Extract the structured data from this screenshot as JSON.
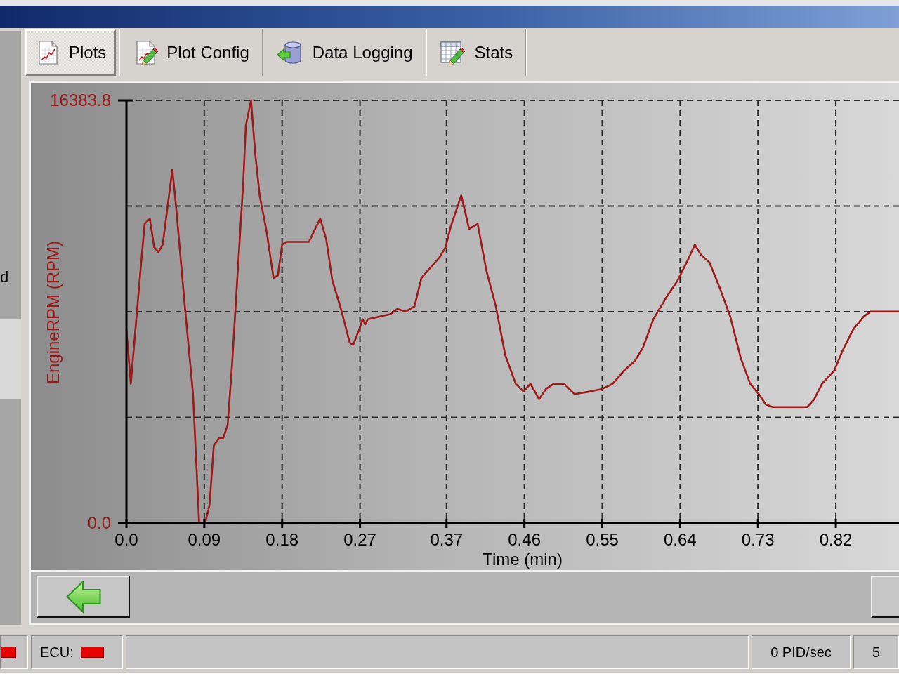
{
  "sidebar": {
    "items": [
      {
        "label": "d",
        "selected": false
      },
      {
        "selected": true
      }
    ]
  },
  "tabs": [
    {
      "label": "Plots",
      "kind": "plot",
      "selected": true
    },
    {
      "label": "Plot Config",
      "kind": "plot_config",
      "selected": false
    },
    {
      "label": "Data Logging",
      "kind": "database",
      "selected": false
    },
    {
      "label": "Stats",
      "kind": "table",
      "selected": false
    }
  ],
  "plot": {
    "chart_data": {
      "type": "line",
      "grid": true,
      "xlabel": "Time (min)",
      "ylabel": "EngineRPM (RPM)",
      "x": [
        0,
        0.005,
        0.016,
        0.021,
        0.027,
        0.032,
        0.037,
        0.042,
        0.053,
        0.057,
        0.067,
        0.077,
        0.084,
        0.091,
        0.096,
        0.101,
        0.107,
        0.112,
        0.117,
        0.122,
        0.128,
        0.135,
        0.138,
        0.144,
        0.149,
        0.154,
        0.162,
        0.17,
        0.175,
        0.18,
        0.185,
        0.211,
        0.224,
        0.231,
        0.238,
        0.248,
        0.258,
        0.262,
        0.269,
        0.273,
        0.276,
        0.279,
        0.292,
        0.305,
        0.313,
        0.323,
        0.333,
        0.341,
        0.362,
        0.369,
        0.375,
        0.387,
        0.392,
        0.396,
        0.406,
        0.416,
        0.427,
        0.438,
        0.45,
        0.459,
        0.467,
        0.477,
        0.485,
        0.494,
        0.506,
        0.518,
        0.536,
        0.55,
        0.562,
        0.575,
        0.588,
        0.597,
        0.609,
        0.625,
        0.637,
        0.649,
        0.657,
        0.664,
        0.674,
        0.686,
        0.698,
        0.71,
        0.721,
        0.731,
        0.739,
        0.747,
        0.787,
        0.795,
        0.804,
        0.818,
        0.828,
        0.84,
        0.852,
        0.86,
        0.893
      ],
      "series": [
        {
          "color": "#a01818",
          "values": [
            7500,
            5400,
            9700,
            11600,
            11800,
            10700,
            10500,
            10800,
            13700,
            12400,
            8600,
            5000,
            0,
            0,
            700,
            3000,
            3300,
            3300,
            3800,
            6100,
            9400,
            13200,
            15400,
            16383.8,
            14300,
            12700,
            11300,
            9500,
            9600,
            10800,
            10900,
            10900,
            11800,
            11000,
            9400,
            8300,
            7000,
            6900,
            7500,
            7900,
            7700,
            7900,
            8000,
            8100,
            8300,
            8200,
            8400,
            9500,
            10300,
            10700,
            11500,
            12700,
            12000,
            11400,
            11600,
            9800,
            8400,
            6500,
            5400,
            5100,
            5400,
            4800,
            5200,
            5400,
            5400,
            5000,
            5100,
            5200,
            5400,
            5900,
            6300,
            6800,
            7900,
            8800,
            9400,
            10200,
            10800,
            10400,
            10100,
            9100,
            8000,
            6400,
            5400,
            5000,
            4600,
            4500,
            4500,
            4800,
            5400,
            5900,
            6700,
            7500,
            8000,
            8200,
            8200
          ]
        }
      ],
      "xlim": [
        0,
        0.893
      ],
      "ylim": [
        0,
        16383.8
      ],
      "xticks": [
        {
          "value": 0,
          "label": "0.0"
        },
        0.09,
        0.18,
        0.27,
        0.37,
        0.46,
        0.55,
        0.64,
        0.73,
        0.82
      ],
      "yticks": [
        {
          "value": 0,
          "label": "0.0"
        },
        16383.8
      ]
    }
  },
  "status_bar": {
    "items": [
      {
        "kind": "indicator",
        "connected": false
      },
      {
        "kind": "indicator",
        "label": "ECU:",
        "connected": false
      },
      {
        "kind": "blank"
      },
      {
        "kind": "text",
        "text": "0 PID/sec"
      },
      {
        "kind": "text",
        "text": "5"
      }
    ]
  }
}
